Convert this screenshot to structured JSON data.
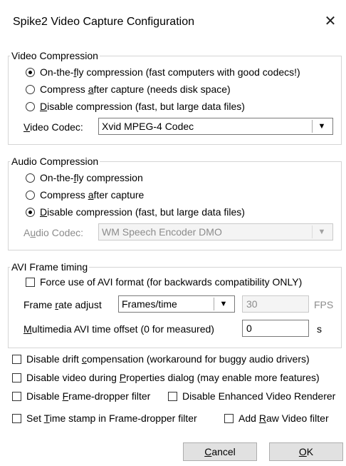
{
  "window": {
    "title": "Spike2 Video Capture Configuration",
    "close_symbol": "✕"
  },
  "video": {
    "legend": "Video Compression",
    "options": [
      {
        "pre": "On-the-",
        "u": "f",
        "post": "ly compression (fast computers with good codecs!)",
        "selected": true
      },
      {
        "pre": "Compress ",
        "u": "a",
        "post": "fter capture (needs disk space)",
        "selected": false
      },
      {
        "pre": "",
        "u": "D",
        "post": "isable compression (fast, but large data files)",
        "selected": false
      }
    ],
    "codec_label": {
      "pre": "",
      "u": "V",
      "post": "ideo Codec:"
    },
    "codec_value": "Xvid MPEG-4 Codec"
  },
  "audio": {
    "legend": "Audio Compression",
    "options": [
      {
        "pre": "On-the-",
        "u": "f",
        "post": "ly compression",
        "selected": false
      },
      {
        "pre": "Compress ",
        "u": "a",
        "post": "fter capture",
        "selected": false
      },
      {
        "pre": "",
        "u": "D",
        "post": "isable compression (fast, but large data files)",
        "selected": true
      }
    ],
    "codec_label": {
      "pre": "A",
      "u": "u",
      "post": "dio Codec:"
    },
    "codec_value": "WM Speech Encoder DMO"
  },
  "timing": {
    "legend": "AVI Frame timing",
    "force_avi": "Force use of AVI format (for backwards compatibility ONLY)",
    "frame_rate_label": {
      "pre": "Frame ",
      "u": "r",
      "post": "ate adjust"
    },
    "frame_rate_value": "Frames/time",
    "fps_value": "30",
    "fps_unit": "FPS",
    "offset_label": {
      "pre": "",
      "u": "M",
      "post": "ultimedia AVI time offset (0 for measured)"
    },
    "offset_value": "0",
    "offset_unit": "s"
  },
  "options": {
    "drift": {
      "pre": "Disable drift ",
      "u": "c",
      "post": "ompensation (workaround for buggy audio drivers)"
    },
    "video_props": {
      "pre": "Disable video during ",
      "u": "P",
      "post": "roperties dialog (may enable more features)"
    },
    "frame_dropper": {
      "pre": "Disable ",
      "u": "F",
      "post": "rame-dropper filter"
    },
    "enhanced_renderer": "Disable Enhanced Video Renderer",
    "timestamp": {
      "pre": "Set ",
      "u": "T",
      "post": "ime stamp in Frame-dropper filter"
    },
    "raw_video": {
      "pre": "Add ",
      "u": "R",
      "post": "aw Video filter"
    }
  },
  "buttons": {
    "cancel": {
      "pre": "",
      "u": "C",
      "post": "ancel"
    },
    "ok": {
      "pre": "",
      "u": "O",
      "post": "K"
    }
  }
}
